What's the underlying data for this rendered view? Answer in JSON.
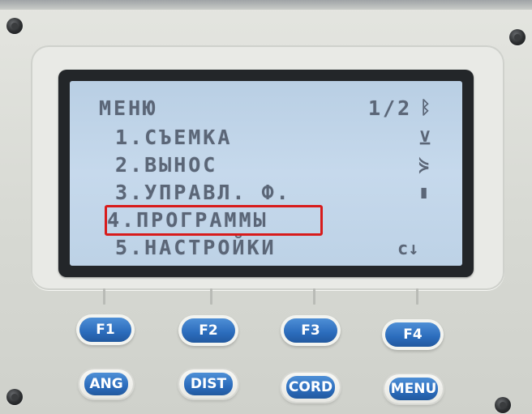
{
  "screen": {
    "title": "МЕНЮ",
    "page_indicator": "1/2",
    "menu_items": [
      {
        "label": "1.СЪЕМКА"
      },
      {
        "label": "2.ВЫНОС"
      },
      {
        "label": "3.УПРАВЛ. Ф."
      },
      {
        "label": "4.ПРОГРАММЫ"
      },
      {
        "label": "5.НАСТРОЙКИ"
      }
    ],
    "selected_index": 3,
    "status_icons": [
      "bluetooth-icon",
      "prism-target-icon",
      "laser-icon",
      "battery-icon",
      "scroll-down-icon"
    ],
    "scroll_glyph": "c↓",
    "highlight_color": "#d81b1b"
  },
  "softkeys": [
    "F1",
    "F2",
    "F3",
    "F4"
  ],
  "function_keys": [
    "ANG",
    "DIST",
    "CORD",
    "MENU"
  ]
}
